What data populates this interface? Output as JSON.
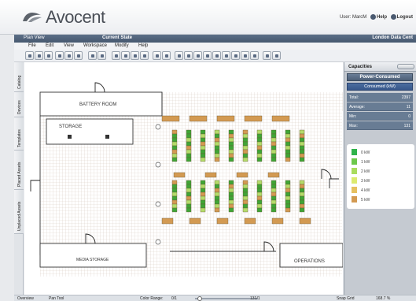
{
  "header": {
    "logo_text": "Avocent",
    "user_label": "User: MarcM",
    "help_label": "Help",
    "logout_label": "Logout"
  },
  "titlebar": {
    "left": "Plan View",
    "middle": "Current State",
    "right": "London Data Cent"
  },
  "menu": [
    "File",
    "Edit",
    "View",
    "Workspace",
    "Modify",
    "Help"
  ],
  "left_tabs": [
    "Catalog",
    "Devices",
    "Templates",
    "Placed Assets",
    "Unplaced Assets"
  ],
  "floor": {
    "room_labels": {
      "battery": "BATTERY ROOM",
      "storage": "STORAGE",
      "media": "MEDIA STORAGE",
      "operations": "OPERATIONS"
    },
    "colors": {
      "grid": "#d9cfc5",
      "wall": "#333333",
      "rack_green": "#3fa535",
      "rack_light": "#b4dc6a",
      "rack_orange": "#d39a52"
    }
  },
  "capacities": {
    "title": "Capacities",
    "mode": "Power-Consumed",
    "metric": "Consumed (kW)",
    "stats": [
      {
        "label": "Total:",
        "value": "2397"
      },
      {
        "label": "Average:",
        "value": "11"
      },
      {
        "label": "Min:",
        "value": "0"
      },
      {
        "label": "Max:",
        "value": "131"
      }
    ],
    "legend": [
      {
        "label": "0 kW",
        "color": "#2fb34a"
      },
      {
        "label": "1 kW",
        "color": "#6cc84b"
      },
      {
        "label": "2 kW",
        "color": "#a9dc5e"
      },
      {
        "label": "3 kW",
        "color": "#dcea70"
      },
      {
        "label": "4 kW",
        "color": "#e6c060"
      },
      {
        "label": "5 kW",
        "color": "#d39a52"
      }
    ]
  },
  "statusbar": {
    "overview": "Overview",
    "mode": "Pan Tool",
    "color_range_label": "Color Range:",
    "range_min": "0/1",
    "range_max": "131/1",
    "snap": "Snap Grid",
    "zoom": "168.7 %"
  }
}
